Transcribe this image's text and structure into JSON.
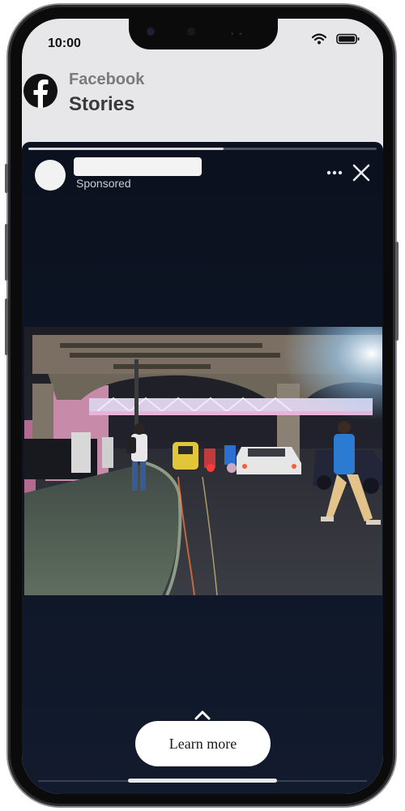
{
  "status_bar": {
    "time": "10:00"
  },
  "header": {
    "app_name": "Facebook",
    "title": "Stories"
  },
  "story": {
    "progress": 0.56,
    "sponsored_label": "Sponsored",
    "cta_label": "Learn more"
  },
  "colors": {
    "story_bg": "#0e1627",
    "facebook_logo": "#111111",
    "cta_bg": "#ffffff"
  },
  "icons": [
    "wifi-icon",
    "battery-icon",
    "facebook-logo-icon",
    "more-options-icon",
    "close-icon",
    "chevron-up-icon"
  ]
}
